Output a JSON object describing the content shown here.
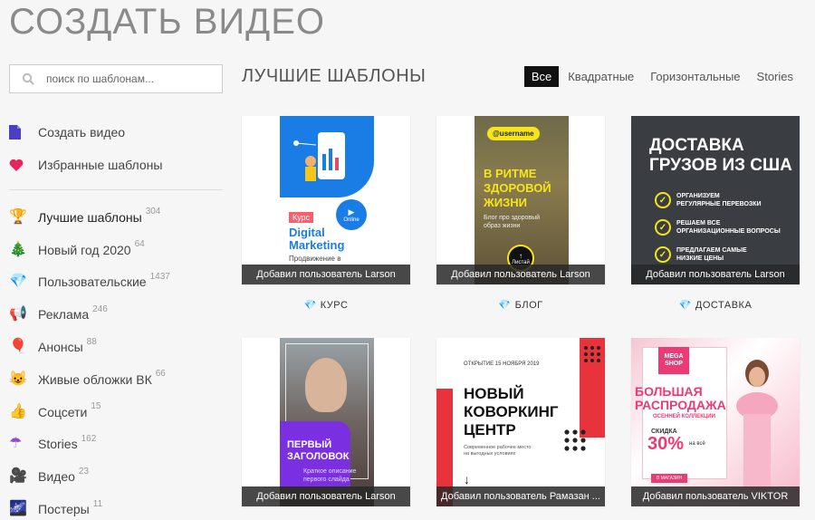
{
  "page": {
    "title": "СОЗДАТЬ ВИДЕО"
  },
  "search": {
    "placeholder": "поиск по шаблонам..."
  },
  "sidebar": {
    "top_items": [
      {
        "label": "Создать видео",
        "icon": "document-icon"
      },
      {
        "label": "Избранные шаблоны",
        "icon": "heart-icon"
      }
    ],
    "categories": [
      {
        "label": "Лучшие шаблоны",
        "count": "304",
        "icon": "trophy-icon",
        "glyph": "🏆"
      },
      {
        "label": "Новый год 2020",
        "count": "64",
        "icon": "christmas-tree-icon",
        "glyph": "🎄"
      },
      {
        "label": "Пользовательские",
        "count": "1437",
        "icon": "gem-icon",
        "glyph": "💎"
      },
      {
        "label": "Реклама",
        "count": "246",
        "icon": "megaphone-icon",
        "glyph": "📢"
      },
      {
        "label": "Анонсы",
        "count": "88",
        "icon": "balloon-icon",
        "glyph": "🎈"
      },
      {
        "label": "Живые обложки ВК",
        "count": "66",
        "icon": "cat-face-icon",
        "glyph": "😺"
      },
      {
        "label": "Соцсети",
        "count": "15",
        "icon": "thumbs-up-icon",
        "glyph": "👍"
      },
      {
        "label": "Stories",
        "count": "162",
        "icon": "umbrella-icon",
        "glyph": "☂"
      },
      {
        "label": "Видео",
        "count": "23",
        "icon": "video-camera-icon",
        "glyph": "🎥"
      },
      {
        "label": "Постеры",
        "count": "11",
        "icon": "poster-icon",
        "glyph": "🌌"
      }
    ]
  },
  "main": {
    "section_title": "ЛУЧШИЕ ШАБЛОНЫ",
    "tabs": [
      {
        "label": "Все",
        "active": true
      },
      {
        "label": "Квадратные",
        "active": false
      },
      {
        "label": "Горизонтальные",
        "active": false
      },
      {
        "label": "Stories",
        "active": false
      }
    ],
    "cards": [
      {
        "credit": "Добавил пользователь Larson",
        "label": "КУРС",
        "art": {
          "badge": "Курс",
          "play": "Online",
          "title1": "Digital",
          "title2": "Marketing",
          "sub": "Продвижение в"
        }
      },
      {
        "credit": "Добавил пользователь Larson",
        "label": "БЛОГ",
        "art": {
          "tag": "@username",
          "l1": "В РИТМЕ",
          "l2": "ЗДОРОВОЙ",
          "l3": "ЖИЗНИ",
          "sub1": "Блог про здоровый",
          "sub2": "образ жизни",
          "btn": "Листай"
        }
      },
      {
        "credit": "Добавил пользователь Larson",
        "label": "ДОСТАВКА",
        "art": {
          "h1": "ДОСТАВКА",
          "h2": "ГРУЗОВ ИЗ США",
          "b1a": "ОРГАНИЗУЕМ",
          "b1b": "РЕГУЛЯРНЫЕ ПЕРЕВОЗКИ",
          "b2a": "РЕШАЕМ ВСЕ",
          "b2b": "ОРГАНИЗАЦИОННЫЕ ВОПРОСЫ",
          "b3a": "ПРЕДЛАГАЕМ САМЫЕ",
          "b3b": "НИЗКИЕ ЦЕНЫ"
        }
      },
      {
        "credit": "Добавил пользователь Larson",
        "art": {
          "h1": "ПЕРВЫЙ",
          "h2": "ЗАГОЛОВОК",
          "sub1": "Краткое описание",
          "sub2": "первого слайда"
        }
      },
      {
        "credit": "Добавил пользователь Рамазан ...",
        "art": {
          "date": "ОТКРЫТИЕ 15 НОЯБРЯ 2019",
          "l1": "НОВЫЙ",
          "l2": "КОВОРКИНГ",
          "l3": "ЦЕНТР",
          "sub1": "Современное рабочее место",
          "sub2": "на выгодных условиях"
        }
      },
      {
        "credit": "Добавил пользователь VIKTOR",
        "art": {
          "logo1": "MEGA",
          "logo2": "SHOP",
          "h1": "БОЛЬШАЯ",
          "h2": "РАСПРОДАЖА",
          "h3": "ОСЕННЕЙ КОЛЛЕКЦИИ",
          "disc_label": "СКИДКА",
          "disc": "30%",
          "disc_sub": "на всё",
          "btn": "В МАГАЗИН"
        }
      }
    ]
  },
  "colors": {
    "accent_blue": "#1a7de6",
    "yellow": "#f5e61a",
    "red": "#e8333c",
    "pink": "#ec3b74",
    "purple": "#7a2fe0",
    "dark": "#3a3d42"
  }
}
